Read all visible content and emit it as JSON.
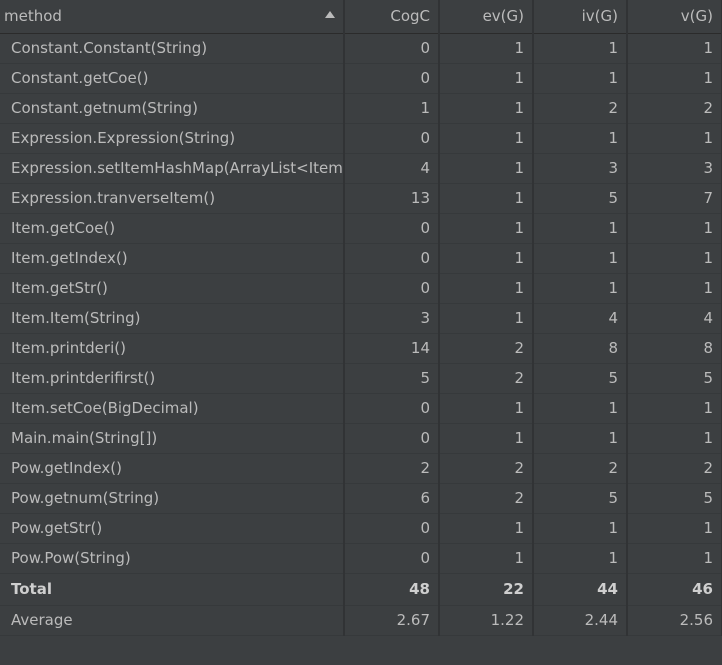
{
  "columns": [
    "method",
    "CogC",
    "ev(G)",
    "iv(G)",
    "v(G)"
  ],
  "rows": [
    {
      "method": "Constant.Constant(String)",
      "CogC": "0",
      "ev": "1",
      "iv": "1",
      "v": "1"
    },
    {
      "method": "Constant.getCoe()",
      "CogC": "0",
      "ev": "1",
      "iv": "1",
      "v": "1"
    },
    {
      "method": "Constant.getnum(String)",
      "CogC": "1",
      "ev": "1",
      "iv": "2",
      "v": "2"
    },
    {
      "method": "Expression.Expression(String)",
      "CogC": "0",
      "ev": "1",
      "iv": "1",
      "v": "1"
    },
    {
      "method": "Expression.setItemHashMap(ArrayList<Item>)",
      "CogC": "4",
      "ev": "1",
      "iv": "3",
      "v": "3"
    },
    {
      "method": "Expression.tranverseItem()",
      "CogC": "13",
      "ev": "1",
      "iv": "5",
      "v": "7"
    },
    {
      "method": "Item.getCoe()",
      "CogC": "0",
      "ev": "1",
      "iv": "1",
      "v": "1"
    },
    {
      "method": "Item.getIndex()",
      "CogC": "0",
      "ev": "1",
      "iv": "1",
      "v": "1"
    },
    {
      "method": "Item.getStr()",
      "CogC": "0",
      "ev": "1",
      "iv": "1",
      "v": "1"
    },
    {
      "method": "Item.Item(String)",
      "CogC": "3",
      "ev": "1",
      "iv": "4",
      "v": "4"
    },
    {
      "method": "Item.printderi()",
      "CogC": "14",
      "ev": "2",
      "iv": "8",
      "v": "8"
    },
    {
      "method": "Item.printderifirst()",
      "CogC": "5",
      "ev": "2",
      "iv": "5",
      "v": "5"
    },
    {
      "method": "Item.setCoe(BigDecimal)",
      "CogC": "0",
      "ev": "1",
      "iv": "1",
      "v": "1"
    },
    {
      "method": "Main.main(String[])",
      "CogC": "0",
      "ev": "1",
      "iv": "1",
      "v": "1"
    },
    {
      "method": "Pow.getIndex()",
      "CogC": "2",
      "ev": "2",
      "iv": "2",
      "v": "2"
    },
    {
      "method": "Pow.getnum(String)",
      "CogC": "6",
      "ev": "2",
      "iv": "5",
      "v": "5"
    },
    {
      "method": "Pow.getStr()",
      "CogC": "0",
      "ev": "1",
      "iv": "1",
      "v": "1"
    },
    {
      "method": "Pow.Pow(String)",
      "CogC": "0",
      "ev": "1",
      "iv": "1",
      "v": "1"
    }
  ],
  "total": {
    "label": "Total",
    "CogC": "48",
    "ev": "22",
    "iv": "44",
    "v": "46"
  },
  "average": {
    "label": "Average",
    "CogC": "2.67",
    "ev": "1.22",
    "iv": "2.44",
    "v": "2.56"
  },
  "colors": {
    "background": "#3c3f41",
    "grid": "#313335",
    "text": "#bbbbbb",
    "active_tab": "#4a88c7"
  }
}
